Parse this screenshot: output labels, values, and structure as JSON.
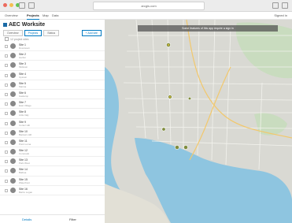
{
  "browser": {
    "url": "arcgis.com"
  },
  "appnav": {
    "items": [
      {
        "label": "Overview"
      },
      {
        "label": "Projects"
      },
      {
        "label": "Map"
      },
      {
        "label": "Data"
      }
    ],
    "right": "Signed in"
  },
  "panel": {
    "title": "AEC Worksite",
    "tabs": [
      {
        "label": "Overview"
      },
      {
        "label": "Projects"
      },
      {
        "label": "Status"
      }
    ],
    "add_label": "+ Add site",
    "list_header": "12 project sites",
    "rows": [
      {
        "title": "Site 1",
        "sub": "Downtown"
      },
      {
        "title": "Site 2",
        "sub": "Harbor"
      },
      {
        "title": "Site 3",
        "sub": "Midtown"
      },
      {
        "title": "Site 4",
        "sub": "Uptown"
      },
      {
        "title": "Site 5",
        "sub": "Marina"
      },
      {
        "title": "Site 6",
        "sub": "Gaslamp"
      },
      {
        "title": "Site 7",
        "sub": "East Village"
      },
      {
        "title": "Site 8",
        "sub": "Little Italy"
      },
      {
        "title": "Site 9",
        "sub": "Cortez Hill"
      },
      {
        "title": "Site 10",
        "sub": "Bankers Hill"
      },
      {
        "title": "Site 11",
        "sub": "Point Loma"
      },
      {
        "title": "Site 12",
        "sub": "Coronado"
      },
      {
        "title": "Site 13",
        "sub": "Park West"
      },
      {
        "title": "Site 14",
        "sub": "Balboa"
      },
      {
        "title": "Site 15",
        "sub": "Waterfront"
      },
      {
        "title": "Site 16",
        "sub": "Barrio Logan"
      }
    ],
    "bottom": [
      "Details",
      "Filter"
    ]
  },
  "map": {
    "banner": "Some features of this app require a sign in"
  }
}
